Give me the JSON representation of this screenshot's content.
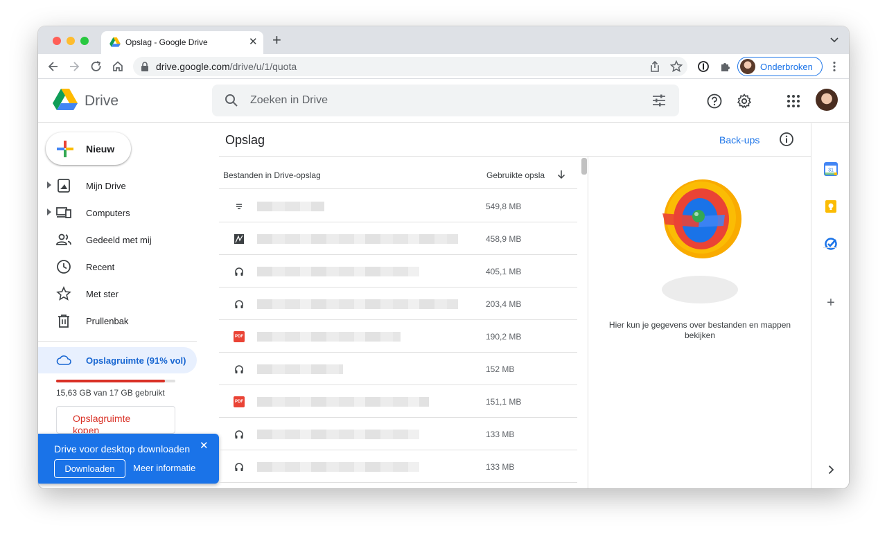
{
  "browser": {
    "tab_title": "Opslag - Google Drive",
    "new_tab": "+",
    "close_tab": "✕",
    "url_host": "drive.google.com",
    "url_path": "/drive/u/1/quota",
    "profile_label": "Onderbroken"
  },
  "header": {
    "app_name": "Drive",
    "search_placeholder": "Zoeken in Drive"
  },
  "sidebar": {
    "new_label": "Nieuw",
    "items": [
      {
        "label": "Mijn Drive"
      },
      {
        "label": "Computers"
      },
      {
        "label": "Gedeeld met mij"
      },
      {
        "label": "Recent"
      },
      {
        "label": "Met ster"
      },
      {
        "label": "Prullenbak"
      }
    ],
    "storage_label": "Opslagruimte (91% vol)",
    "storage_fraction": 0.91,
    "storage_text": "15,63 GB van 17 GB gebruikt",
    "buy_label": "Opslagruimte kopen"
  },
  "banner": {
    "title": "Drive voor desktop downloaden",
    "close": "✕",
    "download_label": "Downloaden",
    "more_label": "Meer informatie"
  },
  "main": {
    "title": "Opslag",
    "backups_label": "Back-ups",
    "col_name": "Bestanden in Drive-opslag",
    "col_size": "Gebruikte opsla",
    "files": [
      {
        "type": "sheet-icon",
        "size": "549,8 MB"
      },
      {
        "type": "image-icon",
        "size": "458,9 MB"
      },
      {
        "type": "audio-icon",
        "size": "405,1 MB"
      },
      {
        "type": "audio-icon",
        "size": "203,4 MB"
      },
      {
        "type": "pdf-icon",
        "size": "190,2 MB"
      },
      {
        "type": "audio-icon",
        "size": "152 MB"
      },
      {
        "type": "pdf-icon",
        "size": "151,1 MB"
      },
      {
        "type": "audio-icon",
        "size": "133 MB"
      },
      {
        "type": "audio-icon",
        "size": "133 MB"
      }
    ],
    "pdf_badge": "PDF",
    "details_text": "Hier kun je gegevens over bestanden en mappen bekijken"
  },
  "rail": {
    "calendar_day": "31",
    "add": "+"
  }
}
